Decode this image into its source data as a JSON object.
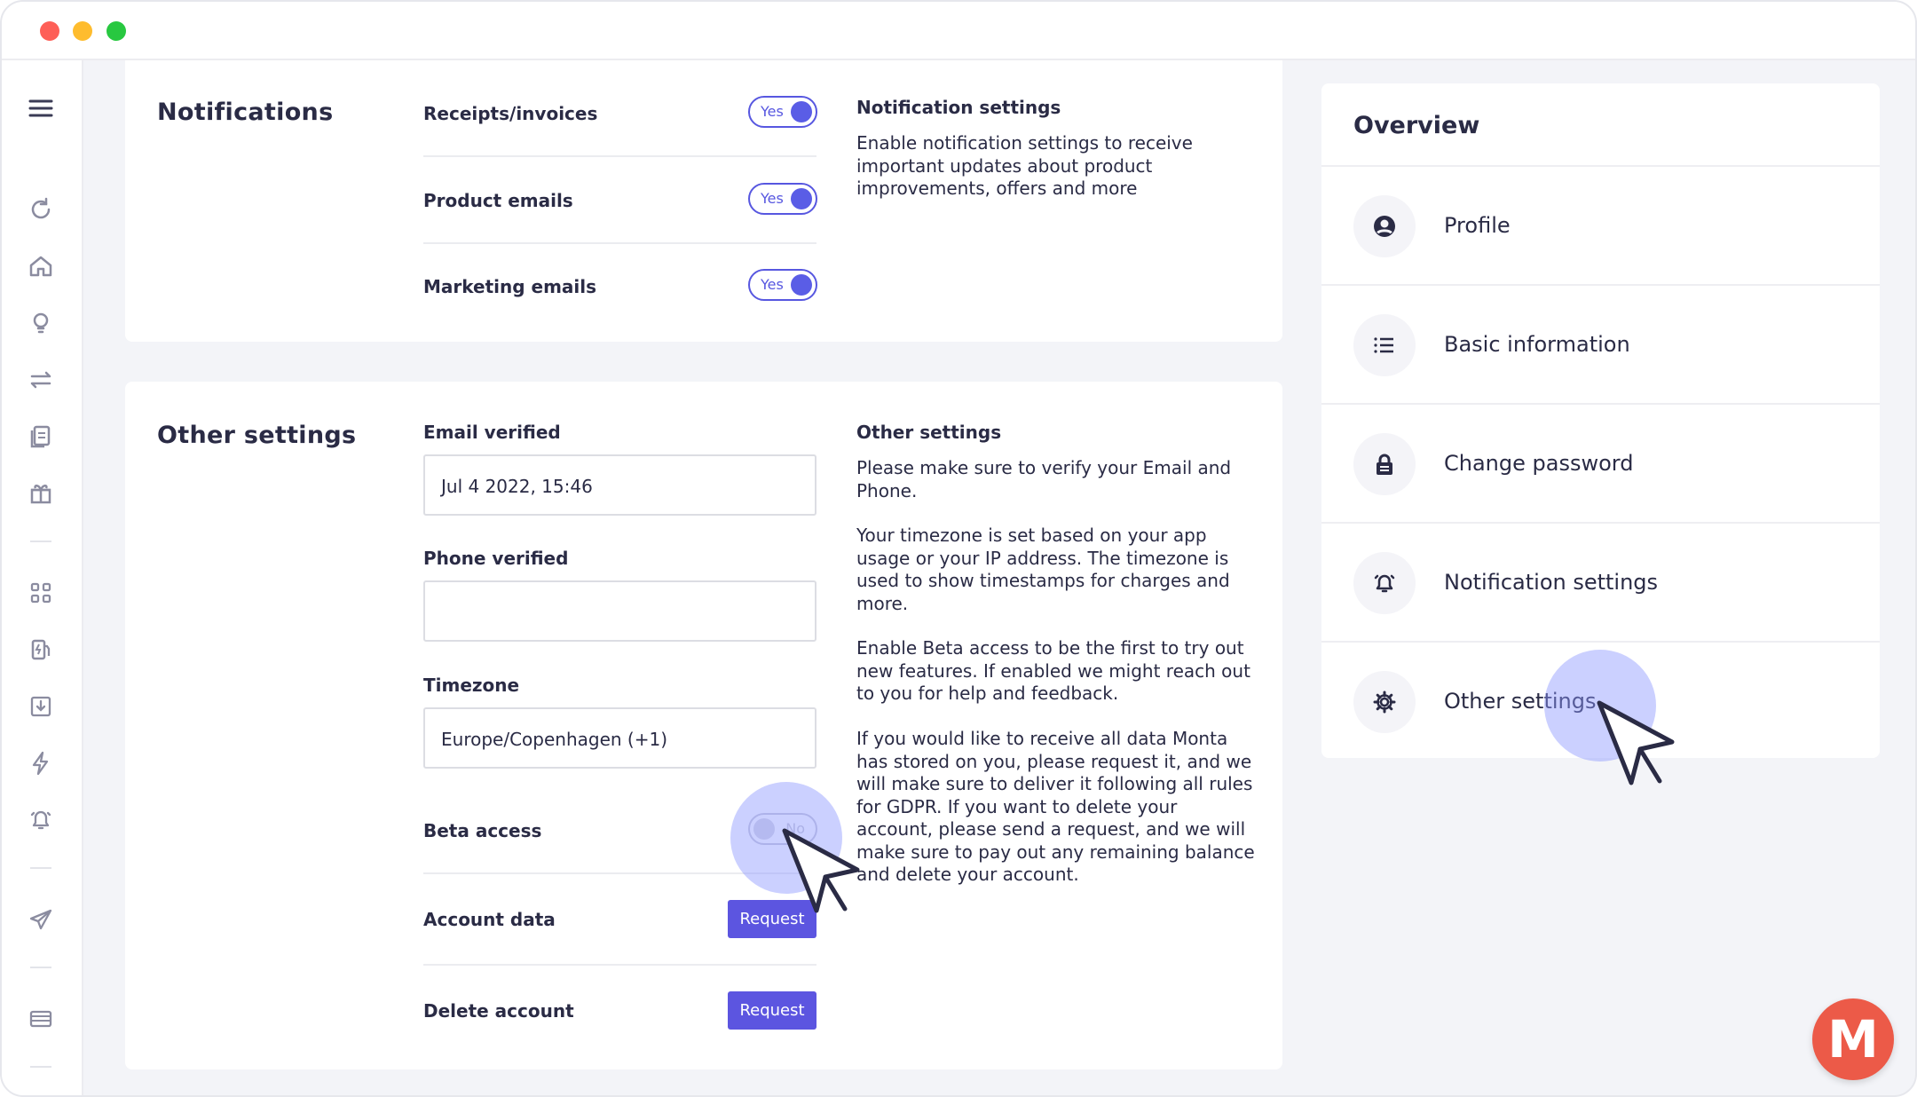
{
  "notifications": {
    "title": "Notifications",
    "rows": [
      {
        "label": "Receipts/invoices",
        "toggle": "Yes"
      },
      {
        "label": "Product emails",
        "toggle": "Yes"
      },
      {
        "label": "Marketing emails",
        "toggle": "Yes"
      }
    ],
    "help_title": "Notification settings",
    "help_text": "Enable notification settings to receive\nimportant updates about product\nimprovements, offers and more"
  },
  "other": {
    "title": "Other settings",
    "email_label": "Email verified",
    "email_value": "Jul 4 2022, 15:46",
    "phone_label": "Phone verified",
    "phone_value": "",
    "timezone_label": "Timezone",
    "timezone_value": "Europe/Copenhagen (+1)",
    "beta_label": "Beta access",
    "beta_toggle": "No",
    "account_data_label": "Account data",
    "account_data_button": "Request",
    "delete_label": "Delete account",
    "delete_button": "Request",
    "help_title": "Other settings",
    "help_p1": "Please make sure to verify your Email and\nPhone.",
    "help_p2": "Your timezone is set based on your app\nusage or your IP address. The timezone is\nused to show timestamps for charges and\nmore.",
    "help_p3": "Enable Beta access to be the first to try out\nnew features. If enabled we might reach out\nto you for help and feedback.",
    "help_p4": "If you would like to receive all data Monta\nhas stored on you, please request it, and we\nwill make sure to deliver it following all rules\nfor GDPR. If you want to delete your\naccount, please send a request, and we will\nmake sure to pay out any remaining balance\nand delete your account."
  },
  "overview": {
    "title": "Overview",
    "items": [
      {
        "label": "Profile",
        "icon": "user-circle-icon"
      },
      {
        "label": "Basic information",
        "icon": "list-icon"
      },
      {
        "label": "Change password",
        "icon": "lock-icon"
      },
      {
        "label": "Notification settings",
        "icon": "bell-icon"
      },
      {
        "label": "Other settings",
        "icon": "gear-icon"
      }
    ]
  },
  "sidebar": {
    "icons": [
      "menu-icon",
      "refresh-icon",
      "home-icon",
      "bulb-icon",
      "transfer-icon",
      "documents-icon",
      "gift-icon",
      "apps-icon",
      "fuel-station-icon",
      "download-icon",
      "lightning-icon",
      "bell-icon",
      "send-icon",
      "card-icon"
    ]
  },
  "brand": {
    "logo_letter": "M",
    "accent": "#5c55e0",
    "logo_color": "#ec5a48"
  }
}
